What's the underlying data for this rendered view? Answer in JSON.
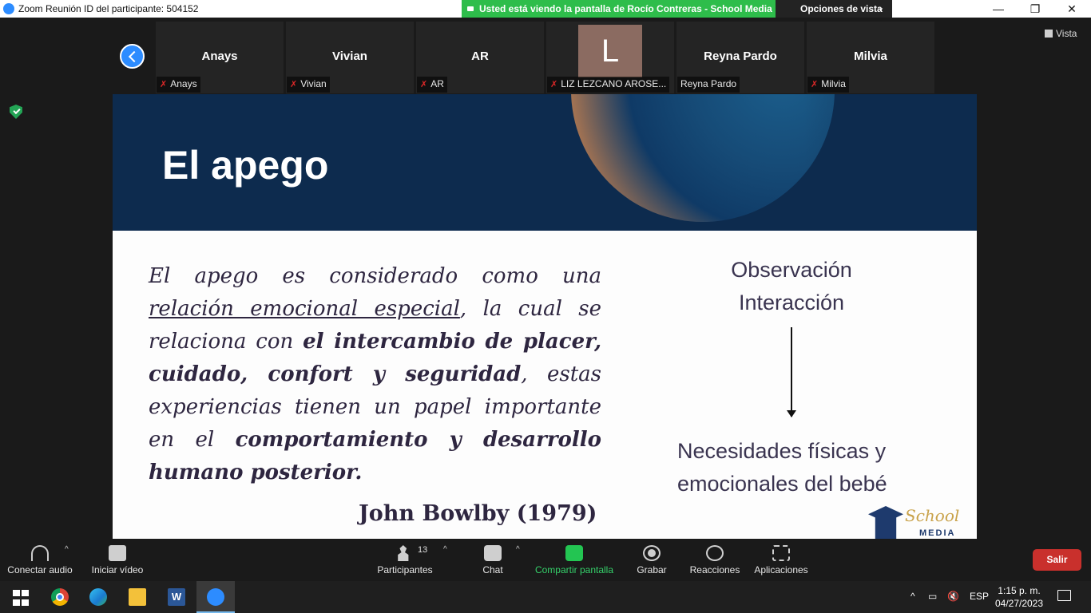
{
  "window": {
    "title": "Zoom Reunión ID del participante: 504152",
    "share_banner": "Usted está viendo la pantalla de Rocío Contreras - School Media",
    "view_options": "Opciones de vista"
  },
  "gallery": {
    "view_label": "Vista",
    "participants": [
      {
        "display": "Anays",
        "label": "Anays",
        "muted": true
      },
      {
        "display": "Vivian",
        "label": "Vivian",
        "muted": true
      },
      {
        "display": "AR",
        "label": "AR",
        "muted": true
      },
      {
        "display": "L",
        "label": "LIZ LEZCANO AROSE...",
        "muted": true
      },
      {
        "display": "Reyna Pardo",
        "label": "Reyna Pardo",
        "muted": false
      },
      {
        "display": "Milvia",
        "label": "Milvia",
        "muted": true
      }
    ]
  },
  "slide": {
    "title": "El apego",
    "body_segments": [
      {
        "text": "El apego es considerado como una ",
        "style": "normal"
      },
      {
        "text": "relación emocional especial",
        "style": "underline"
      },
      {
        "text": ", la cual se relaciona con ",
        "style": "normal"
      },
      {
        "text": "el intercambio de placer, cuidado, confort  y seguridad",
        "style": "bold"
      },
      {
        "text": ", estas experiencias tienen un papel importante en el ",
        "style": "normal"
      },
      {
        "text": "comportamiento y desarrollo humano posterior.",
        "style": "bold"
      }
    ],
    "author": "John Bowlby (1979)",
    "observation_lines": [
      "Observación",
      "Interacción"
    ],
    "needs_text": "Necesidades físicas y emocionales del bebé",
    "logo_text": "School",
    "logo_sub": "MEDIA"
  },
  "toolbar": {
    "audio": "Conectar audio",
    "video": "Iniciar vídeo",
    "participants": "Participantes",
    "participants_count": "13",
    "chat": "Chat",
    "share": "Compartir pantalla",
    "record": "Grabar",
    "reactions": "Reacciones",
    "apps": "Aplicaciones",
    "leave": "Salir"
  },
  "taskbar": {
    "language": "ESP",
    "time": "1:15 p. m.",
    "date": "04/27/2023"
  },
  "colors": {
    "share_green": "#2ebd4b",
    "zoom_blue": "#2d8cff",
    "leave_red": "#c9302c",
    "slide_navy": "#0d2b4e"
  }
}
